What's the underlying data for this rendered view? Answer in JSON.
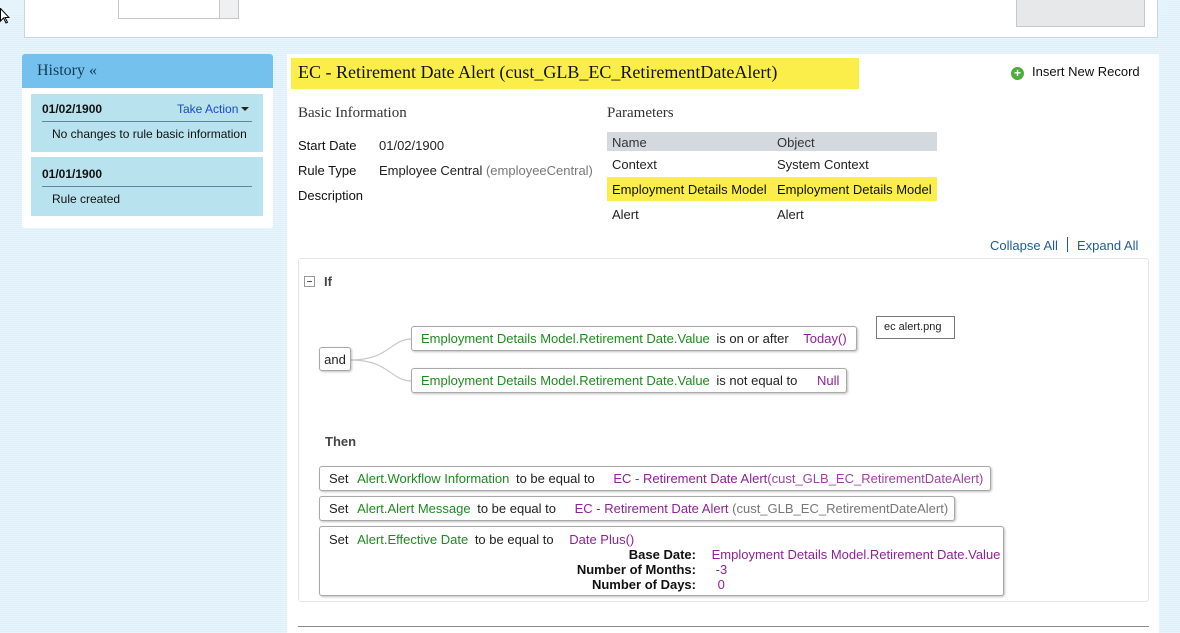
{
  "history": {
    "title": "History «",
    "entries": [
      {
        "date": "01/02/1900",
        "action": "Take Action",
        "text": "No changes to rule basic information"
      },
      {
        "date": "01/01/1900",
        "text": "Rule created"
      }
    ]
  },
  "rule": {
    "title": "EC - Retirement Date Alert (cust_GLB_EC_RetirementDateAlert)",
    "insert_label": "Insert New Record"
  },
  "basic_info": {
    "heading": "Basic Information",
    "start_date_label": "Start Date",
    "start_date": "01/02/1900",
    "rule_type_label": "Rule Type",
    "rule_type": "Employee Central",
    "rule_type_code": "(employeeCentral)",
    "description_label": "Description"
  },
  "parameters": {
    "heading": "Parameters",
    "col_name": "Name",
    "col_object": "Object",
    "rows": [
      {
        "name": "Context",
        "object": "System Context"
      },
      {
        "name": "Employment Details Model",
        "object": "Employment Details Model"
      },
      {
        "name": "Alert",
        "object": "Alert"
      }
    ]
  },
  "controls": {
    "collapse_all": "Collapse All",
    "expand_all": "Expand All"
  },
  "if_block": {
    "label": "If",
    "operator": "and",
    "conditions": [
      {
        "field": "Employment Details Model.Retirement Date.Value",
        "op": "is on or after",
        "value": "Today()"
      },
      {
        "field": "Employment Details Model.Retirement Date.Value",
        "op": "is not equal to",
        "value": "Null"
      }
    ]
  },
  "attachment_label": "ec alert.png",
  "then_block": {
    "label": "Then",
    "actions": [
      {
        "verb": "Set",
        "field": "Alert.Workflow Information",
        "op": "to be equal to",
        "value": "EC - Retirement Date Alert",
        "value_suffix": "(cust_GLB_EC_RetirementDateAlert)"
      },
      {
        "verb": "Set",
        "field": "Alert.Alert Message",
        "op": "to be equal to",
        "value": "EC - Retirement Date Alert",
        "value_suffix": "(cust_GLB_EC_RetirementDateAlert)"
      },
      {
        "verb": "Set",
        "field": "Alert.Effective Date",
        "op": "to be equal to",
        "value": "Date Plus()",
        "params": [
          {
            "label": "Base Date:",
            "value": "Employment Details Model.Retirement Date.Value"
          },
          {
            "label": "Number of Months:",
            "value": "-3"
          },
          {
            "label": "Number of Days:",
            "value": "0"
          }
        ]
      }
    ]
  },
  "colors": {
    "highlight": "#fbee4b",
    "history_header": "#74c1ee",
    "history_item": "#b8e3ee",
    "field_green": "#1f8a1f",
    "value_purple": "#8e2395",
    "link_blue": "#1e5e98"
  }
}
